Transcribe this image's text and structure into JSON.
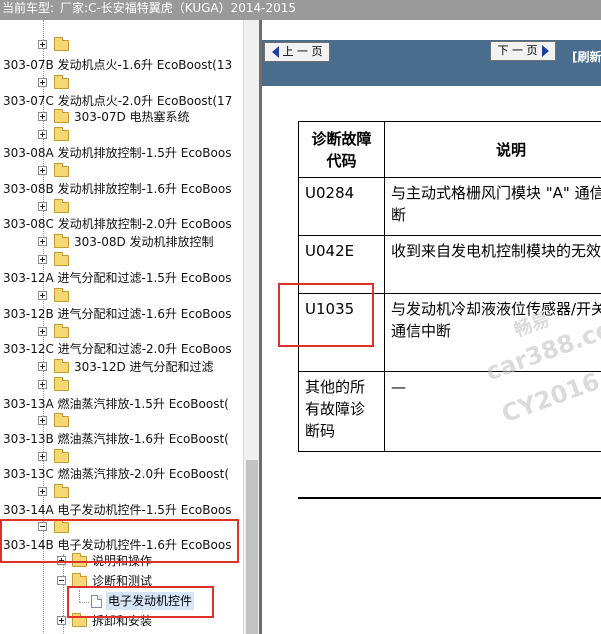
{
  "header": {
    "caption": "当前车型:",
    "model": "厂家:C-长安福特翼虎（KUGA）2014-2015"
  },
  "tree": {
    "items": [
      {
        "label": "",
        "type": "folder"
      },
      {
        "label": "303-07B 发动机点火-1.6升 EcoBoost(13",
        "type": "section"
      },
      {
        "label": "",
        "type": "folder"
      },
      {
        "label": "303-07C 发动机点火-2.0升 EcoBoost(17",
        "type": "section"
      },
      {
        "label": "303-07D 电热塞系统",
        "type": "folder-labeled"
      },
      {
        "label": "",
        "type": "folder"
      },
      {
        "label": "303-08A 发动机排放控制-1.5升 EcoBoos",
        "type": "section"
      },
      {
        "label": "",
        "type": "folder"
      },
      {
        "label": "303-08B 发动机排放控制-1.6升 EcoBoos",
        "type": "section"
      },
      {
        "label": "",
        "type": "folder"
      },
      {
        "label": "303-08C 发动机排放控制-2.0升 EcoBoos",
        "type": "section"
      },
      {
        "label": "303-08D 发动机排放控制",
        "type": "folder-labeled"
      },
      {
        "label": "",
        "type": "folder"
      },
      {
        "label": "303-12A 进气分配和过滤-1.5升 EcoBoos",
        "type": "section"
      },
      {
        "label": "",
        "type": "folder"
      },
      {
        "label": "303-12B 进气分配和过滤-1.6升 EcoBoos",
        "type": "section"
      },
      {
        "label": "",
        "type": "folder"
      },
      {
        "label": "303-12C 进气分配和过滤-2.0升 EcoBoos",
        "type": "section"
      },
      {
        "label": "303-12D 进气分配和过滤",
        "type": "folder-labeled"
      },
      {
        "label": "",
        "type": "folder"
      },
      {
        "label": "303-13A 燃油蒸汽排放-1.5升 EcoBoost(",
        "type": "section"
      },
      {
        "label": "",
        "type": "folder"
      },
      {
        "label": "303-13B 燃油蒸汽排放-1.6升 EcoBoost(",
        "type": "section"
      },
      {
        "label": "",
        "type": "folder"
      },
      {
        "label": "303-13C 燃油蒸汽排放-2.0升 EcoBoost(",
        "type": "section"
      },
      {
        "label": "",
        "type": "folder"
      },
      {
        "label": "303-14A 电子发动机控件-1.5升 EcoBoos",
        "type": "section"
      },
      {
        "label": "",
        "type": "folder-open"
      },
      {
        "label": "303-14B 电子发动机控件-1.6升 EcoBoos",
        "type": "section"
      },
      {
        "label": "说明和操作",
        "type": "child-folder"
      },
      {
        "label": "诊断和测试",
        "type": "child-folder-open"
      },
      {
        "label": "电子发动机控件",
        "type": "doc"
      },
      {
        "label": "拆卸和安装",
        "type": "child-folder"
      }
    ]
  },
  "toolbar": {
    "prev_label": "上 一 页",
    "next_label": "下 一 页",
    "refresh_label": "[刷新"
  },
  "table": {
    "headers": [
      "诊断故障代码",
      "说明"
    ],
    "rows": [
      [
        "U0284",
        "与主动式格栅风门模块 \"A\" 通信中断"
      ],
      [
        "U042E",
        "收到来自发电机控制模块的无效数据"
      ],
      [
        "U1035",
        "与发动机冷却液液位传感器/开关的通信中断"
      ],
      [
        "其他的所有故障诊断码",
        "—"
      ]
    ]
  },
  "watermark": {
    "line1": "畅易",
    "line2": "car388.co",
    "line3": "CY2016"
  },
  "colors": {
    "highlight_box": "#e0302a",
    "nav_bar": "#4a6d8e",
    "header_bar": "#9a9a9a"
  }
}
